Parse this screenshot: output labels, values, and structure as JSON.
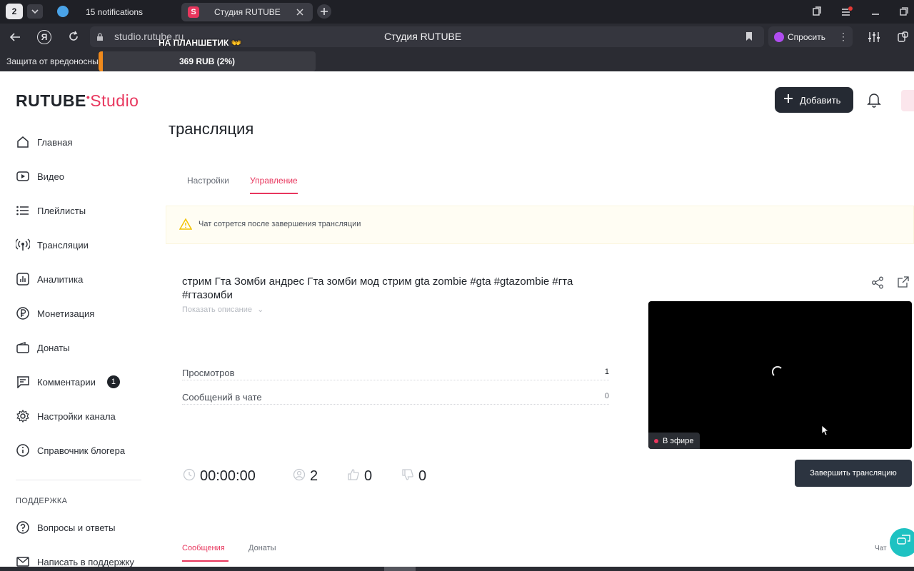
{
  "browser": {
    "tab_count_badge": "2",
    "tabs": [
      {
        "title": "15 notifications"
      },
      {
        "title": "Студия RUTUBE"
      }
    ],
    "url": "studio.rutube.ru",
    "page_title": "Студия RUTUBE",
    "ask_button": "Спросить",
    "bookmark_item": "Защита от вредоносны"
  },
  "overlay": {
    "title": "НА ПЛАНШЕТИК",
    "amount": "369 RUB (2%)"
  },
  "header": {
    "logo_main": "RUTUBE",
    "logo_sub": "Studio",
    "add_button": "Добавить"
  },
  "sidebar": {
    "items": [
      {
        "label": "Главная",
        "icon": "home-icon"
      },
      {
        "label": "Видео",
        "icon": "video-icon"
      },
      {
        "label": "Плейлисты",
        "icon": "playlist-icon"
      },
      {
        "label": "Трансляции",
        "icon": "broadcast-icon"
      },
      {
        "label": "Аналитика",
        "icon": "analytics-icon"
      },
      {
        "label": "Монетизация",
        "icon": "ruble-icon"
      },
      {
        "label": "Донаты",
        "icon": "wallet-icon"
      },
      {
        "label": "Комментарии",
        "icon": "comment-icon",
        "badge": "1"
      },
      {
        "label": "Настройки канала",
        "icon": "gear-icon"
      },
      {
        "label": "Справочник блогера",
        "icon": "info-icon"
      }
    ],
    "support_heading": "ПОДДЕРЖКА",
    "support_items": [
      {
        "label": "Вопросы и ответы",
        "icon": "question-icon"
      },
      {
        "label": "Написать в поддержку",
        "icon": "mail-icon"
      }
    ]
  },
  "main": {
    "page_heading": "трансляция",
    "tabs": [
      {
        "label": "Настройки",
        "active": false
      },
      {
        "label": "Управление",
        "active": true
      }
    ],
    "warning": "Чат сотрется после завершения трансляции",
    "stream_title": "стрим Гта Зомби андрес Гта зомби мод стрим gta zombie #gta #gtazombie #гта #гтазомби",
    "show_description": "Показать описание",
    "stats": [
      {
        "label": "Просмотров",
        "value": "1"
      },
      {
        "label": "Сообщений в чате",
        "value": "0"
      }
    ],
    "live_badge": "В эфире",
    "end_button": "Завершить трансляцию",
    "counters": {
      "timer": "00:00:00",
      "viewers": "2",
      "likes": "0",
      "dislikes": "0"
    },
    "bottom_tabs": [
      {
        "label": "Сообщения",
        "active": true
      },
      {
        "label": "Донаты",
        "active": false
      }
    ],
    "chat_label": "Чат"
  },
  "colors": {
    "accent": "#e8365d",
    "dark_button": "#2c3440",
    "warning_bg": "#fffdf2",
    "warning_icon": "#f2c200"
  }
}
